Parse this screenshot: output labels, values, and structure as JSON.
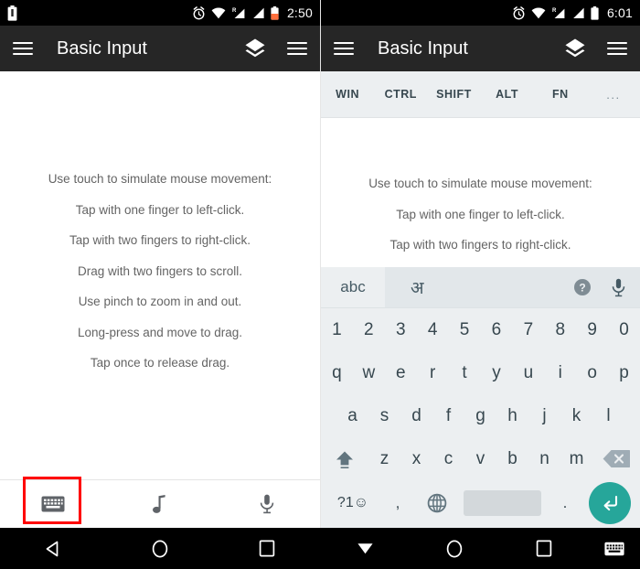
{
  "left_panel": {
    "statusbar": {
      "battery_icon": "battery-icon",
      "alarm_icon": "alarm-icon",
      "wifi_icon": "wifi-icon",
      "signal_roaming_icon": "signal-roaming-icon",
      "signal_icon": "signal-icon",
      "battery_right_icon": "battery-icon",
      "time": "2:50"
    },
    "appbar": {
      "menu_icon": "hamburger-menu-icon",
      "title": "Basic Input",
      "layers_icon": "layers-icon",
      "list_icon": "list-menu-icon"
    },
    "instructions": [
      "Use touch to simulate mouse movement:",
      "Tap with one finger to left-click.",
      "Tap with two fingers to right-click.",
      "Drag with two fingers to scroll.",
      "Use pinch to zoom in and out.",
      "Long-press and move to drag.",
      "Tap once to release drag."
    ],
    "bottombar": {
      "keyboard_icon": "keyboard-icon",
      "music_icon": "music-note-icon",
      "mic_icon": "microphone-icon",
      "highlight_color": "#ff0000",
      "highlighted_item": "keyboard-icon"
    }
  },
  "right_panel": {
    "statusbar": {
      "alarm_icon": "alarm-icon",
      "wifi_icon": "wifi-icon",
      "signal_roaming_icon": "signal-roaming-icon",
      "signal_icon": "signal-icon",
      "battery_icon": "battery-icon",
      "time": "6:01"
    },
    "appbar": {
      "menu_icon": "hamburger-menu-icon",
      "title": "Basic Input",
      "layers_icon": "layers-icon",
      "list_icon": "list-menu-icon"
    },
    "modifier_keys": [
      "WIN",
      "CTRL",
      "SHIFT",
      "ALT",
      "FN",
      "..."
    ],
    "instructions": [
      "Use touch to simulate mouse movement:",
      "Tap with one finger to left-click.",
      "Tap with two fingers to right-click."
    ],
    "keyboard": {
      "suggestion_bar": {
        "abc_label": "abc",
        "language_label": "अ",
        "help_icon": "help-circle-icon",
        "mic_icon": "microphone-icon"
      },
      "row_numbers": [
        "1",
        "2",
        "3",
        "4",
        "5",
        "6",
        "7",
        "8",
        "9",
        "0"
      ],
      "row_top": [
        "q",
        "w",
        "e",
        "r",
        "t",
        "y",
        "u",
        "i",
        "o",
        "p"
      ],
      "row_home": [
        "a",
        "s",
        "d",
        "f",
        "g",
        "h",
        "j",
        "k",
        "l"
      ],
      "row_bottom": [
        "z",
        "x",
        "c",
        "v",
        "b",
        "n",
        "m"
      ],
      "shift_icon": "shift-arrow-icon",
      "backspace_icon": "backspace-icon",
      "symbols_label": "?1☺",
      "comma_label": ",",
      "globe_icon": "globe-language-icon",
      "space_label": "",
      "period_label": ".",
      "enter_icon": "enter-return-icon",
      "enter_color": "#26a69a"
    }
  },
  "navbar": {
    "left": {
      "back_icon": "back-triangle-icon",
      "home_icon": "home-circle-icon",
      "recents_icon": "recents-square-icon"
    },
    "right": {
      "hide_keyboard_icon": "hide-keyboard-down-icon",
      "home_icon": "home-circle-icon",
      "recents_icon": "recents-square-icon",
      "keyboard_icon": "keyboard-icon"
    }
  }
}
